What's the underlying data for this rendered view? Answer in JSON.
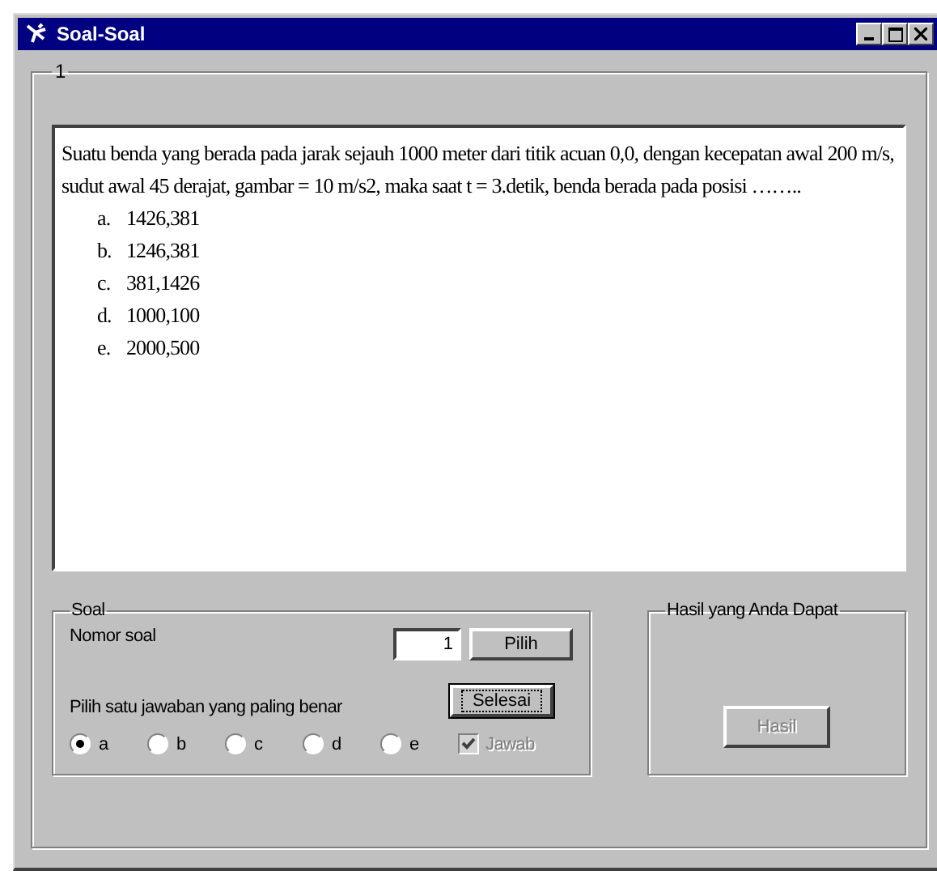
{
  "window": {
    "title": "Soal-Soal"
  },
  "frame": {
    "title": "1"
  },
  "question": {
    "text": "Suatu benda yang berada pada jarak sejauh 1000 meter dari titik acuan 0,0, dengan kecepatan awal 200 m/s, sudut awal 45 derajat, gambar = 10 m/s2, maka saat t = 3.detik, benda berada pada posisi  ……..",
    "options": [
      {
        "letter": "a.",
        "text": "1426,381"
      },
      {
        "letter": "b.",
        "text": "1246,381"
      },
      {
        "letter": "c.",
        "text": "381,1426"
      },
      {
        "letter": "d.",
        "text": "1000,100"
      },
      {
        "letter": "e.",
        "text": "2000,500"
      }
    ]
  },
  "soal": {
    "title": "Soal",
    "nomor_label": "Nomor soal",
    "nomor_value": "1",
    "pilih_button": "Pilih",
    "selesai_button": {
      "label": "Selesai",
      "focused": true
    },
    "instruction": "Pilih satu jawaban yang paling benar",
    "answers": [
      {
        "label": "a",
        "selected": true
      },
      {
        "label": "b",
        "selected": false
      },
      {
        "label": "c",
        "selected": false
      },
      {
        "label": "d",
        "selected": false
      },
      {
        "label": "e",
        "selected": false
      }
    ],
    "jawab": {
      "label": "Jawab",
      "checked": true,
      "disabled": true
    }
  },
  "hasil": {
    "title": "Hasil yang Anda Dapat",
    "button": {
      "label": "Hasil",
      "disabled": true
    }
  }
}
